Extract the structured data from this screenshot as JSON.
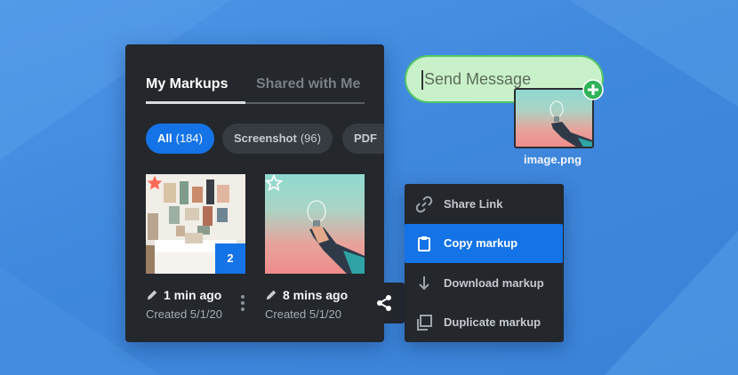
{
  "panel": {
    "tabs": [
      {
        "label": "My Markups",
        "active": true
      },
      {
        "label": "Shared with Me",
        "active": false
      }
    ],
    "filters": [
      {
        "label": "All",
        "count": "(184)",
        "active": true
      },
      {
        "label": "Screenshot",
        "count": "(96)",
        "active": false
      },
      {
        "label": "PDF",
        "count": "",
        "active": false
      }
    ],
    "cards": [
      {
        "time": "1 min ago",
        "created": "Created 5/1/20",
        "starred": true,
        "badge": "2"
      },
      {
        "time": "8 mins ago",
        "created": "Created 5/1/20",
        "starred": false
      }
    ]
  },
  "context_menu": {
    "items": [
      {
        "label": "Share Link",
        "icon": "link-icon",
        "highlighted": false
      },
      {
        "label": "Copy markup",
        "icon": "clipboard-icon",
        "highlighted": true
      },
      {
        "label": "Download markup",
        "icon": "download-icon",
        "highlighted": false
      },
      {
        "label": "Duplicate markup",
        "icon": "duplicate-icon",
        "highlighted": false
      }
    ]
  },
  "message": {
    "placeholder": "Send Message"
  },
  "attachment": {
    "filename": "image.png"
  },
  "colors": {
    "accent": "#1473e6",
    "panel": "#24272c",
    "message_bg": "#c9f1c9",
    "message_border": "#52c768",
    "star": "#ff6b57"
  }
}
